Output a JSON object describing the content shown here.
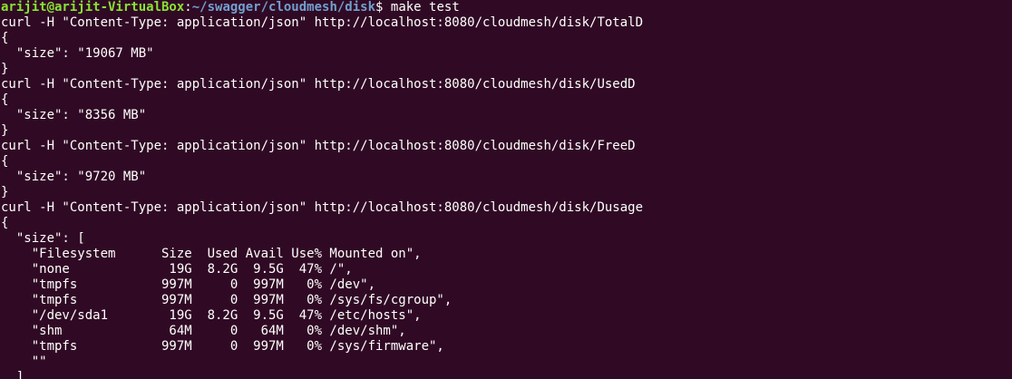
{
  "prompt": {
    "user_host": "arijit@arijit-VirtualBox",
    "separator": ":",
    "path": "~/swagger/cloudmesh/disk",
    "symbol": "$ ",
    "command": "make test"
  },
  "colors": {
    "background": "#300a24",
    "user_host": "#8ae234",
    "path": "#729fcf",
    "text": "#ffffff"
  },
  "output": [
    "curl -H \"Content-Type: application/json\" http://localhost:8080/cloudmesh/disk/TotalD",
    "{",
    "  \"size\": \"19067 MB\"",
    "}",
    "curl -H \"Content-Type: application/json\" http://localhost:8080/cloudmesh/disk/UsedD",
    "{",
    "  \"size\": \"8356 MB\"",
    "}",
    "curl -H \"Content-Type: application/json\" http://localhost:8080/cloudmesh/disk/FreeD",
    "{",
    "  \"size\": \"9720 MB\"",
    "}",
    "curl -H \"Content-Type: application/json\" http://localhost:8080/cloudmesh/disk/Dusage",
    "{",
    "  \"size\": [",
    "    \"Filesystem      Size  Used Avail Use% Mounted on\",",
    "    \"none             19G  8.2G  9.5G  47% /\",",
    "    \"tmpfs           997M     0  997M   0% /dev\",",
    "    \"tmpfs           997M     0  997M   0% /sys/fs/cgroup\",",
    "    \"/dev/sda1        19G  8.2G  9.5G  47% /etc/hosts\",",
    "    \"shm              64M     0   64M   0% /dev/shm\",",
    "    \"tmpfs           997M     0  997M   0% /sys/firmware\",",
    "    \"\"",
    "  ]"
  ]
}
